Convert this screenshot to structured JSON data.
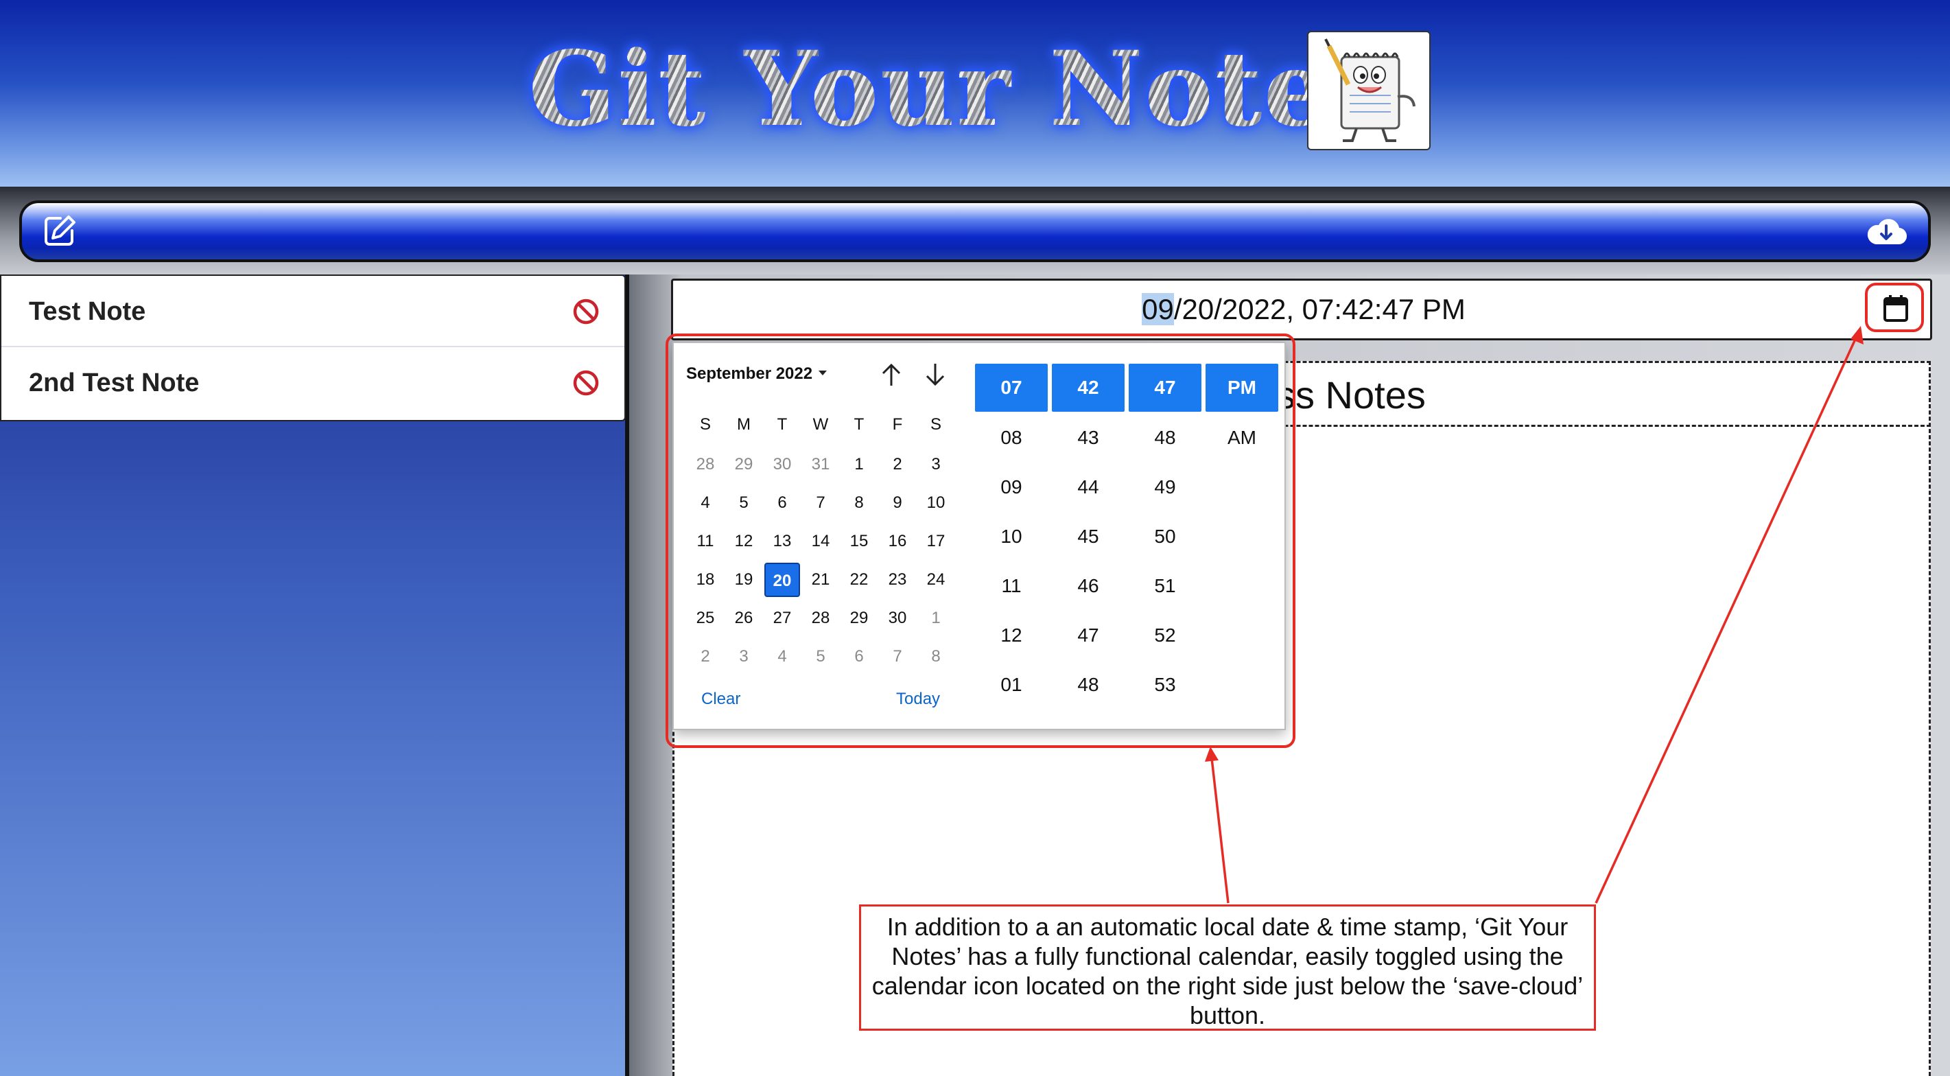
{
  "header": {
    "title": "Git Your Notes",
    "mascot_icon": "notepad-mascot-icon"
  },
  "toolbar": {
    "new_note_icon": "edit-pencil-icon",
    "save_icon": "cloud-download-icon"
  },
  "sidebar": {
    "notes": [
      {
        "label": "Test Note",
        "delete_icon": "no-entry-icon"
      },
      {
        "label": "2nd Test Note",
        "delete_icon": "no-entry-icon"
      }
    ]
  },
  "main": {
    "datetime": {
      "highlight": "09",
      "rest": "/20/2022, 07:42:47 PM",
      "calendar_icon": "calendar-icon"
    },
    "note_title_partial": "ss Notes"
  },
  "picker": {
    "month_label": "September 2022",
    "weekdays": [
      "S",
      "M",
      "T",
      "W",
      "T",
      "F",
      "S"
    ],
    "weeks": [
      [
        "28",
        "29",
        "30",
        "31",
        "1",
        "2",
        "3"
      ],
      [
        "4",
        "5",
        "6",
        "7",
        "8",
        "9",
        "10"
      ],
      [
        "11",
        "12",
        "13",
        "14",
        "15",
        "16",
        "17"
      ],
      [
        "18",
        "19",
        "20",
        "21",
        "22",
        "23",
        "24"
      ],
      [
        "25",
        "26",
        "27",
        "28",
        "29",
        "30",
        "1"
      ],
      [
        "2",
        "3",
        "4",
        "5",
        "6",
        "7",
        "8"
      ]
    ],
    "muted_days": [
      [
        0,
        0
      ],
      [
        0,
        1
      ],
      [
        0,
        2
      ],
      [
        0,
        3
      ],
      [
        4,
        6
      ],
      [
        5,
        0
      ],
      [
        5,
        1
      ],
      [
        5,
        2
      ],
      [
        5,
        3
      ],
      [
        5,
        4
      ],
      [
        5,
        5
      ],
      [
        5,
        6
      ]
    ],
    "selected_day": "20",
    "clear_label": "Clear",
    "today_label": "Today",
    "time": {
      "hour": "07",
      "minute": "42",
      "second": "47",
      "period": "PM",
      "hours": [
        "08",
        "09",
        "10",
        "11",
        "12",
        "01"
      ],
      "minutes": [
        "43",
        "44",
        "45",
        "46",
        "47",
        "48"
      ],
      "seconds": [
        "48",
        "49",
        "50",
        "51",
        "52",
        "53"
      ],
      "periods": [
        "AM"
      ]
    }
  },
  "annotation": {
    "text": "In addition to a an automatic local date & time stamp, ‘Git Your Notes’ has a fully functional calendar, easily toggled using the calendar icon located on the right side just below the ‘save-cloud’ button.",
    "color": "#e62a24"
  }
}
